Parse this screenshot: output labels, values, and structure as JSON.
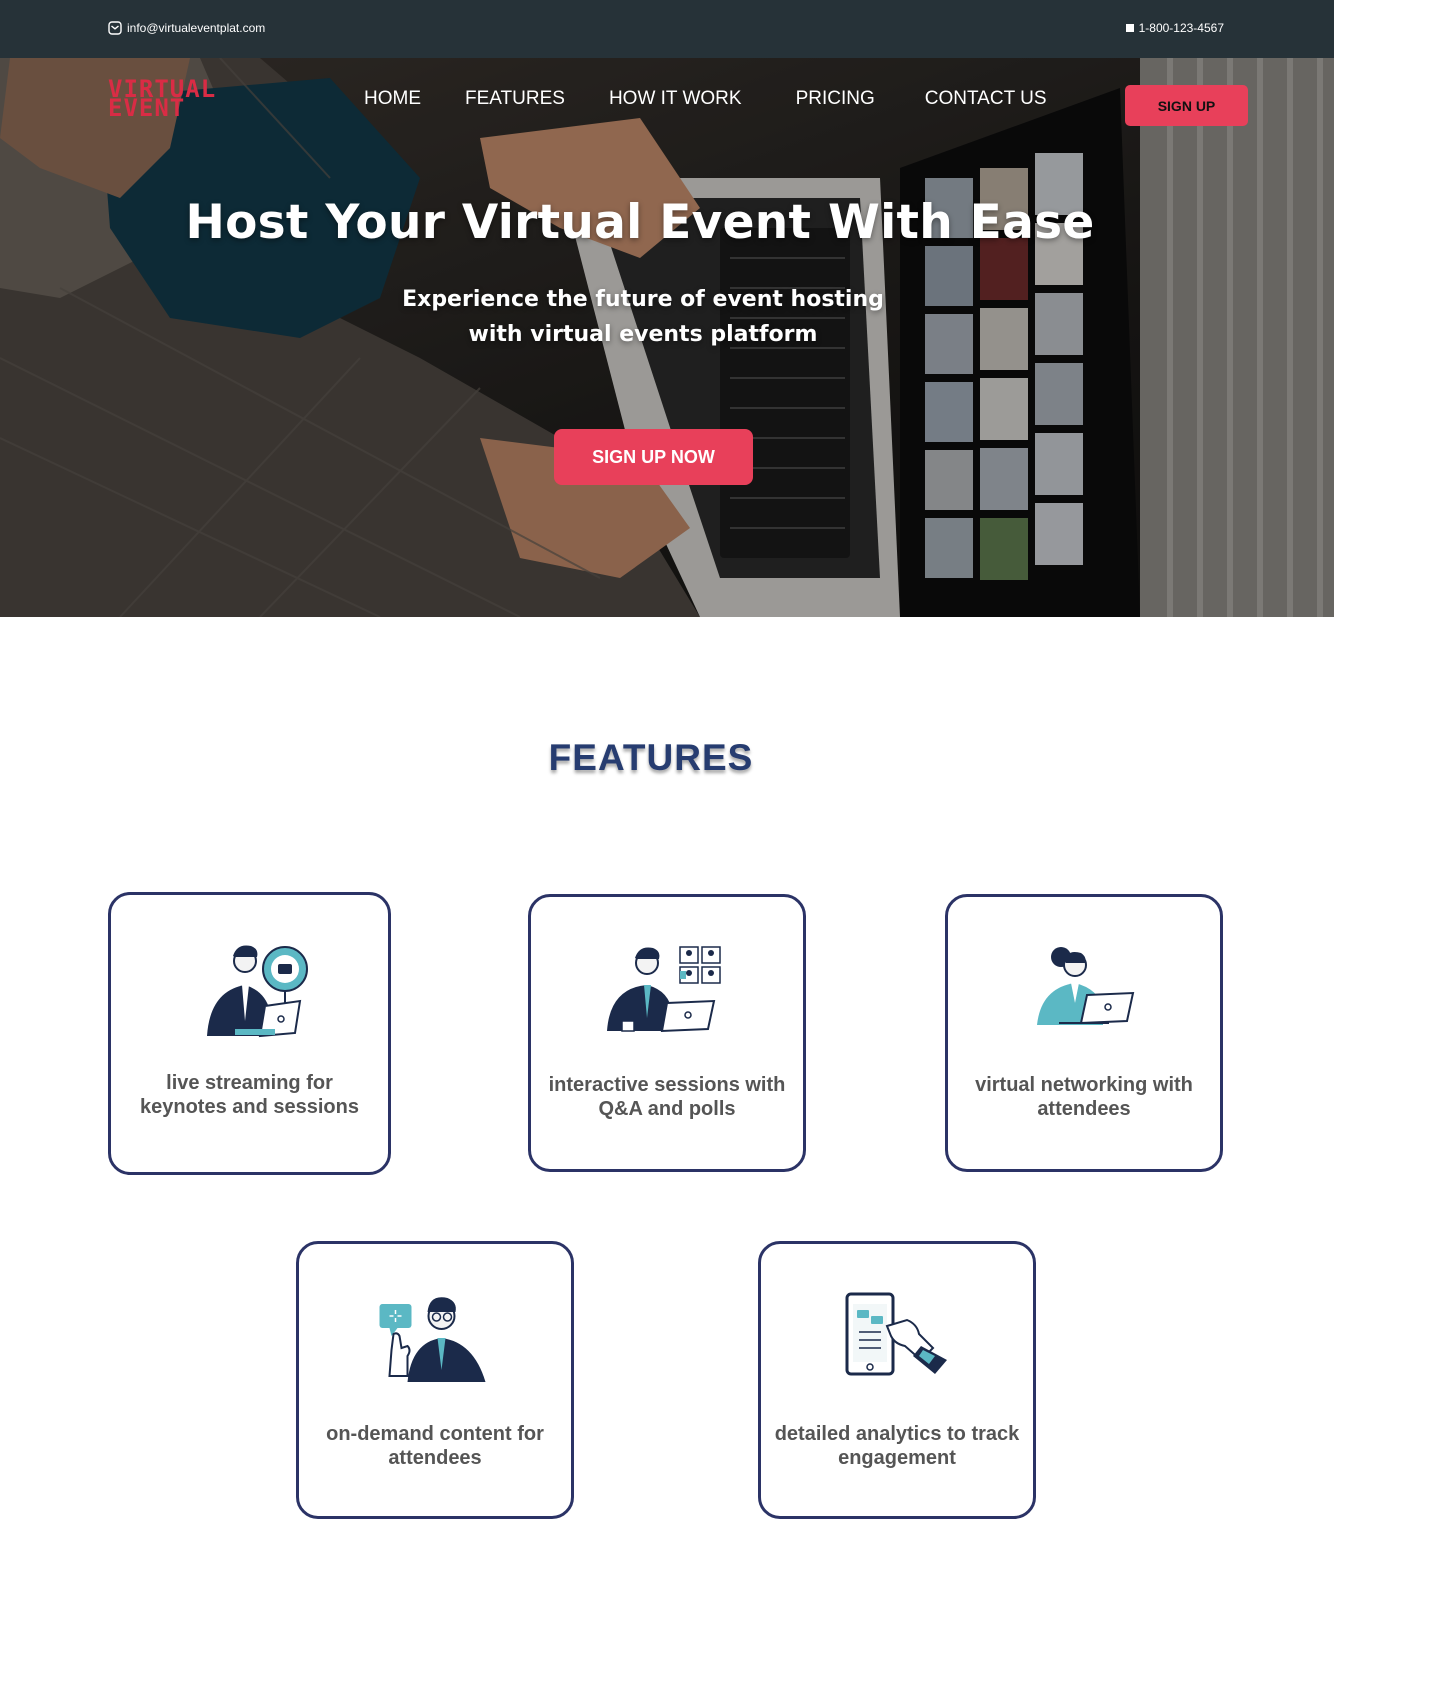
{
  "topbar": {
    "email": "info@virtualeventplat.com",
    "phone": "1-800-123-4567"
  },
  "header": {
    "logo_line1": "VIRTUAL",
    "logo_line2": "EVENT",
    "nav": [
      "HOME",
      "FEATURES",
      "HOW IT WORK",
      "PRICING",
      "CONTACT US"
    ],
    "signup_label": "SIGN UP"
  },
  "hero": {
    "title": "Host Your Virtual Event With Ease",
    "subtitle": "Experience the future of event hosting with virtual events platform",
    "cta_label": "SIGN UP NOW"
  },
  "features": {
    "heading": "FEATURES",
    "items": [
      {
        "label": "live streaming for keynotes and sessions",
        "icon": "live-streaming-illustration"
      },
      {
        "label": "interactive sessions with Q&A and polls",
        "icon": "video-conference-illustration"
      },
      {
        "label": "virtual networking with attendees",
        "icon": "networking-laptop-illustration"
      },
      {
        "label": "on-demand content for attendees",
        "icon": "chat-bubble-illustration"
      },
      {
        "label": "detailed analytics to track engagement",
        "icon": "tablet-checklist-illustration"
      }
    ]
  },
  "colors": {
    "topbar_bg": "#263238",
    "accent": "#e8405a",
    "heading": "#263c70",
    "card_border": "#2b3366",
    "illustration_navy": "#1b2a4a",
    "illustration_teal": "#5bb8c4"
  }
}
